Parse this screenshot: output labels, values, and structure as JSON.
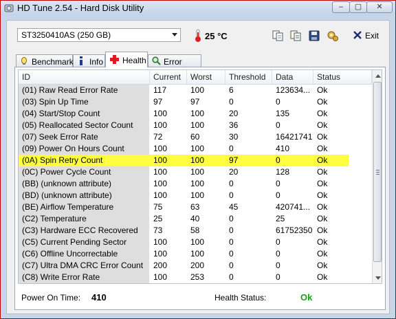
{
  "window": {
    "title": "HD Tune 2.54 - Hard Disk Utility"
  },
  "toolbar": {
    "drive": "ST3250410AS (250 GB)",
    "temperature": "25 °C",
    "exit_label": "Exit",
    "icons": [
      "copy-icon",
      "copy-all-icon",
      "save-icon",
      "options-icon",
      "exit-icon"
    ]
  },
  "tabs": [
    {
      "label": "Benchmark",
      "icon": "benchmark-icon"
    },
    {
      "label": "Info",
      "icon": "info-icon"
    },
    {
      "label": "Health",
      "icon": "health-cross-icon"
    },
    {
      "label": "Error Scan",
      "icon": "magnifier-icon"
    }
  ],
  "grid": {
    "columns": [
      "ID",
      "Current",
      "Worst",
      "Threshold",
      "Data",
      "Status"
    ],
    "highlight_color": "#ffff40",
    "rows": [
      [
        "(01) Raw Read Error Rate",
        "117",
        "100",
        "6",
        "123634...",
        "Ok"
      ],
      [
        "(03) Spin Up Time",
        "97",
        "97",
        "0",
        "0",
        "Ok"
      ],
      [
        "(04) Start/Stop Count",
        "100",
        "100",
        "20",
        "135",
        "Ok"
      ],
      [
        "(05) Reallocated Sector Count",
        "100",
        "100",
        "36",
        "0",
        "Ok"
      ],
      [
        "(07) Seek Error Rate",
        "72",
        "60",
        "30",
        "16421741",
        "Ok"
      ],
      [
        "(09) Power On Hours Count",
        "100",
        "100",
        "0",
        "410",
        "Ok"
      ],
      [
        "(0A) Spin Retry Count",
        "100",
        "100",
        "97",
        "0",
        "Ok"
      ],
      [
        "(0C) Power Cycle Count",
        "100",
        "100",
        "20",
        "128",
        "Ok"
      ],
      [
        "(BB) (unknown attribute)",
        "100",
        "100",
        "0",
        "0",
        "Ok"
      ],
      [
        "(BD) (unknown attribute)",
        "100",
        "100",
        "0",
        "0",
        "Ok"
      ],
      [
        "(BE) Airflow Temperature",
        "75",
        "63",
        "45",
        "420741...",
        "Ok"
      ],
      [
        "(C2) Temperature",
        "25",
        "40",
        "0",
        "25",
        "Ok"
      ],
      [
        "(C3) Hardware ECC Recovered",
        "73",
        "58",
        "0",
        "61752350",
        "Ok"
      ],
      [
        "(C5) Current Pending Sector",
        "100",
        "100",
        "0",
        "0",
        "Ok"
      ],
      [
        "(C6) Offline Uncorrectable",
        "100",
        "100",
        "0",
        "0",
        "Ok"
      ],
      [
        "(C7) Ultra DMA CRC Error Count",
        "200",
        "200",
        "0",
        "0",
        "Ok"
      ],
      [
        "(C8) Write Error Rate",
        "100",
        "253",
        "0",
        "0",
        "Ok"
      ]
    ]
  },
  "footer": {
    "power_on_label": "Power On Time:",
    "power_on_value": "410",
    "health_label": "Health Status:",
    "health_value": "Ok",
    "health_color": "#1c9e1c"
  }
}
